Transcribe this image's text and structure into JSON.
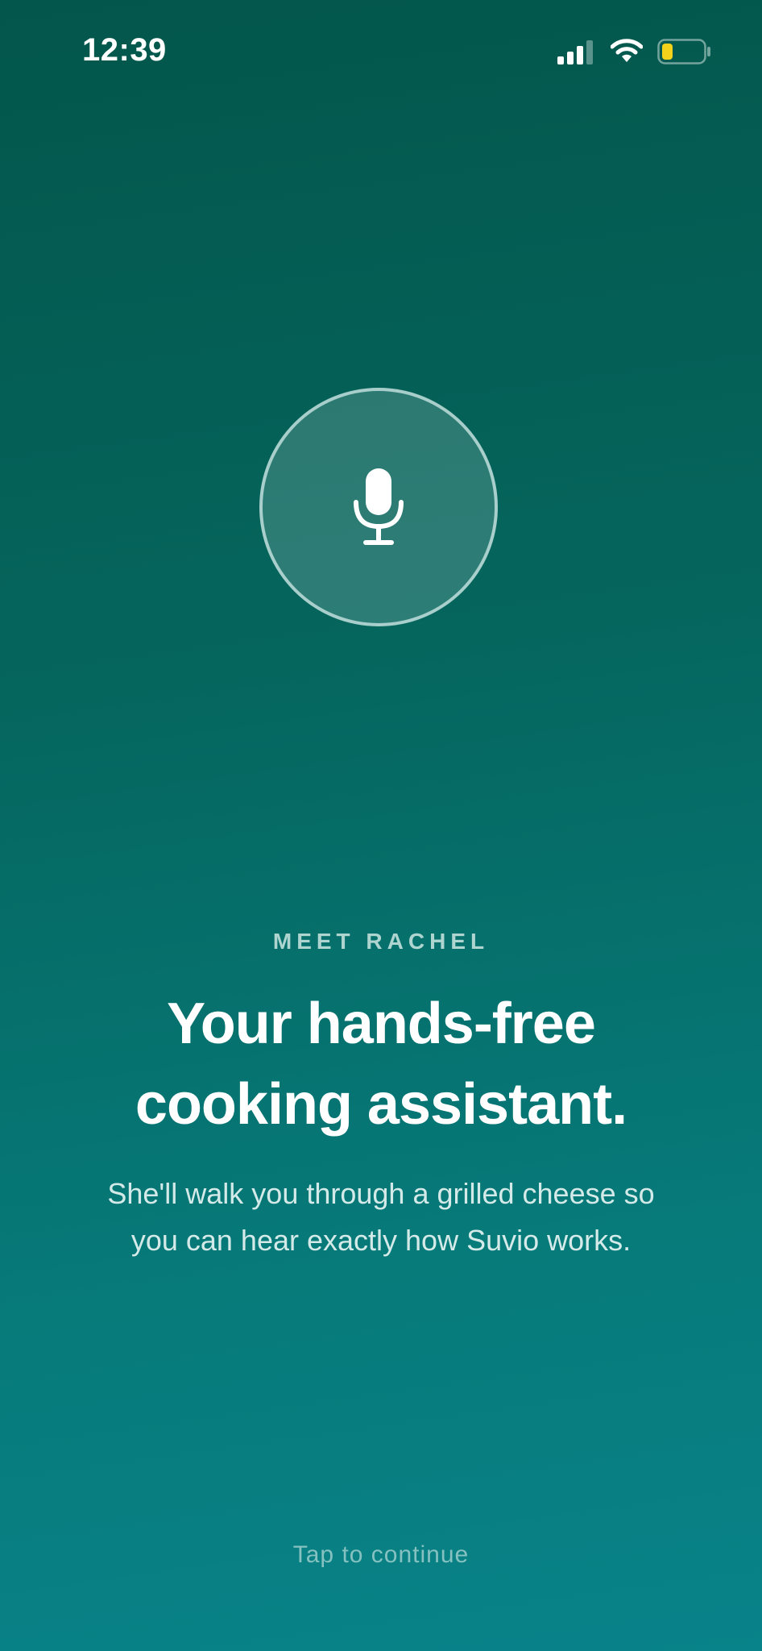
{
  "status_bar": {
    "time": "12:39",
    "battery_color": "#f4d21c"
  },
  "mic": {
    "icon": "microphone-icon"
  },
  "intro": {
    "eyebrow": "MEET RACHEL",
    "headline_line1": "Your hands-free",
    "headline_line2": "cooking assistant.",
    "subtitle_line1": "She'll walk you through a grilled cheese so",
    "subtitle_line2": "you can hear exactly how Suvio works."
  },
  "footer": {
    "continue_label": "Tap to continue"
  },
  "colors": {
    "background_top": "#03564b",
    "background_bottom": "#088389"
  }
}
